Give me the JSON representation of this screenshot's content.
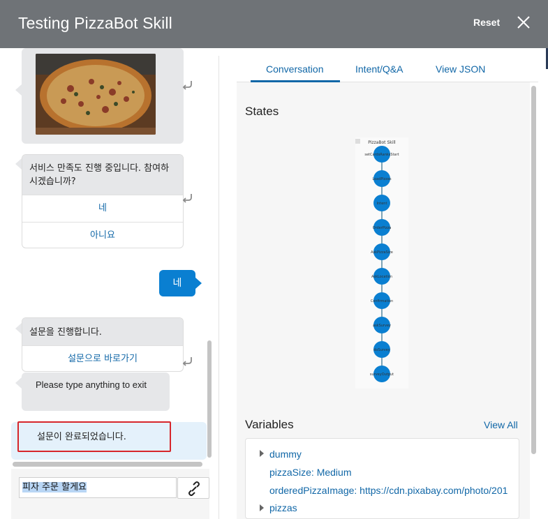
{
  "window": {
    "title": "Testing PizzaBot Skill",
    "reset_label": "Reset"
  },
  "chat": {
    "survey_prompt": "서비스 만족도 진행 중입니다. 참여하시겠습니까?",
    "choices": [
      "네",
      "아니요"
    ],
    "user_reply": "네",
    "survey_start": "설문을 진행합니다.",
    "survey_link": "설문으로 바로가기",
    "type_prompt": "Please type anything to exit",
    "survey_done": "설문이 완료되었습니다.",
    "input_value": "피자 주문 할게요"
  },
  "tabs": [
    {
      "label": "Conversation",
      "active": true
    },
    {
      "label": "Intent/Q&A",
      "active": false
    },
    {
      "label": "View JSON",
      "active": false
    }
  ],
  "states": {
    "title": "States",
    "diagram_title": "PizzaBot Skill",
    "nodes": [
      "setCardsRanksStart",
      "LoadPizzas",
      "Intent",
      "OrderPizza",
      "AskPizzaSize",
      "AskLocation",
      "Confirmation",
      "askSurvey",
      "doSurvey",
      "surveyOutput"
    ]
  },
  "variables": {
    "title": "Variables",
    "view_all": "View All",
    "items": [
      {
        "text": "dummy",
        "expandable": true
      },
      {
        "text": "pizzaSize: Medium",
        "expandable": false
      },
      {
        "text": "orderedPizzaImage: https://cdn.pixabay.com/photo/201",
        "expandable": false
      },
      {
        "text": "pizzas",
        "expandable": true
      }
    ]
  },
  "colors": {
    "header": "#6f7377",
    "accent": "#0a7fd1",
    "link": "#1167a7",
    "highlight_border": "#d6262b"
  }
}
